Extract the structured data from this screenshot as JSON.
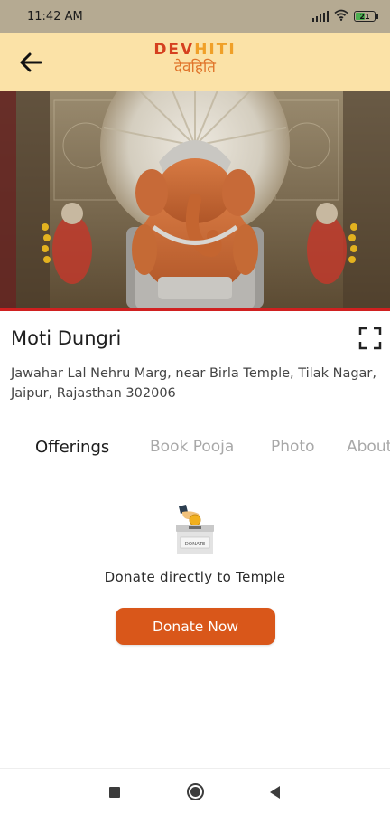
{
  "status_bar": {
    "time": "11:42 AM",
    "icons": [
      "signal-icon",
      "wifi-icon",
      "battery-icon"
    ],
    "battery_level": "21"
  },
  "header": {
    "logo_part1": "DEV",
    "logo_part2": "HITI",
    "logo_hindi": "देवहिति",
    "back_icon": "arrow-left-icon",
    "colors": {
      "background": "#fbe2a7",
      "dev": "#d5401f",
      "hiti": "#f0a028"
    }
  },
  "temple": {
    "name": "Moti Dungri",
    "address": "Jawahar Lal Nehru Marg, near Birla Temple, Tilak Nagar, Jaipur, Rajasthan 302006",
    "photo_description_icon": "ganesha-idol-photo",
    "fullscreen_icon": "fullscreen-icon"
  },
  "tabs": [
    {
      "label": "Offerings",
      "active": true
    },
    {
      "label": "Book Pooja",
      "active": false
    },
    {
      "label": "Photo",
      "active": false
    },
    {
      "label": "About",
      "active": false
    }
  ],
  "offerings": {
    "illustration_icon": "donation-box-icon",
    "box_label": "DONATE",
    "message": "Donate directly to Temple",
    "button_label": "Donate Now",
    "button_color": "#d9571a"
  },
  "nav_bar": {
    "icons": [
      "recents-icon",
      "home-icon",
      "back-icon"
    ]
  }
}
